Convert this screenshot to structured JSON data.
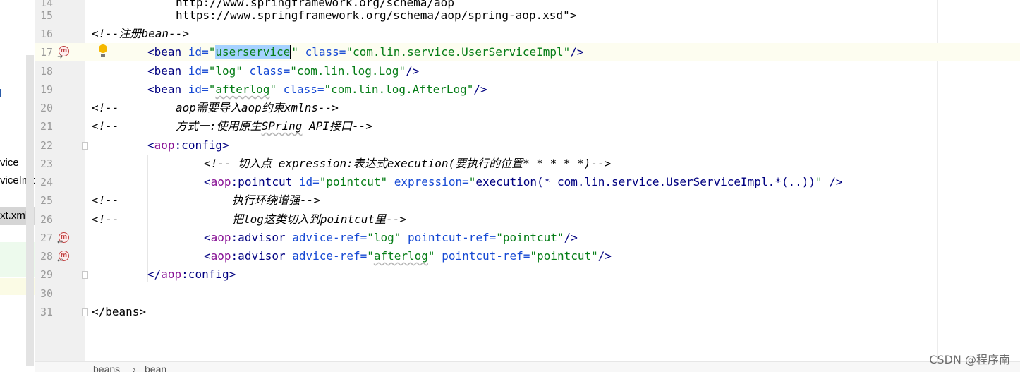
{
  "left_panel": {
    "items": [
      "vice",
      "viceImp",
      "xt.xml"
    ]
  },
  "lines": [
    {
      "num": "14",
      "text": "http://www.springframework.org/schema/aop"
    },
    {
      "num": "15",
      "text": "https://www.springframework.org/schema/aop/spring-aop.xsd\">"
    },
    {
      "num": "16"
    },
    {
      "num": "17"
    },
    {
      "num": "18"
    },
    {
      "num": "19"
    },
    {
      "num": "20"
    },
    {
      "num": "21"
    },
    {
      "num": "22"
    },
    {
      "num": "23"
    },
    {
      "num": "24"
    },
    {
      "num": "25"
    },
    {
      "num": "26"
    },
    {
      "num": "27"
    },
    {
      "num": "28"
    },
    {
      "num": "29"
    },
    {
      "num": "30"
    },
    {
      "num": "31"
    }
  ],
  "code": {
    "l16_comment": "<!--注册bean-->",
    "l17": {
      "open": "<bean ",
      "id_attr": "id=",
      "q1": "\"",
      "id_val": "userservice",
      "q2": "\" ",
      "class_attr": "class=",
      "class_val": "\"com.lin.service.UserServiceImpl\"",
      "close": "/>"
    },
    "l18": {
      "open": "<bean ",
      "id_attr": "id=",
      "id_val": "\"log\" ",
      "class_attr": "class=",
      "class_val": "\"com.lin.log.Log\"",
      "close": "/>"
    },
    "l19": {
      "open": "<bean ",
      "id_attr": "id=",
      "q1": "\"",
      "id_val": "afterlog",
      "q2": "\" ",
      "class_attr": "class=",
      "class_val": "\"com.lin.log.AfterLog\"",
      "close": "/>"
    },
    "l20_a": "<!--",
    "l20_b": "aop需要导入aop约束xmlns-->",
    "l21_a": "<!--",
    "l21_b1": "方式一:使用原生",
    "l21_b2": "SPring",
    "l21_b3": " API接口-->",
    "l22": {
      "lt": "<",
      "ns": "aop",
      "tag": ":config",
      "gt": ">"
    },
    "l23_comment": "<!-- 切入点 expression:表达式execution(要执行的位置* * * * *)-->",
    "l24": {
      "lt": "<",
      "ns": "aop",
      "tag": ":pointcut ",
      "id_attr": "id=",
      "id_val": "\"pointcut\" ",
      "expr_attr": "expression=",
      "expr_q1": "\"",
      "expr_val": "execution(* com.lin.service.UserServiceImpl.*(..))",
      "expr_q2": "\"",
      "close": " />"
    },
    "l25_a": "<!--",
    "l25_b": "执行环绕增强-->",
    "l26_a": "<!--",
    "l26_b": "把log这类切入到pointcut里-->",
    "l27": {
      "lt": "<",
      "ns": "aop",
      "tag": ":advisor ",
      "a1": "advice-ref=",
      "v1": "\"log\" ",
      "a2": "pointcut-ref=",
      "v2": "\"pointcut\"",
      "close": "/>"
    },
    "l28": {
      "lt": "<",
      "ns": "aop",
      "tag": ":advisor ",
      "a1": "advice-ref=",
      "q1": "\"",
      "v1": "afterlog",
      "q2": "\" ",
      "a2": "pointcut-ref=",
      "v2": "\"pointcut\"",
      "close": "/>"
    },
    "l29": {
      "lt": "</",
      "ns": "aop",
      "tag": ":config",
      "gt": ">"
    },
    "l31": "</beans>"
  },
  "gutter_icons": {
    "method_marker": "m"
  },
  "breadcrumb": [
    "beans",
    "›",
    "bean"
  ],
  "watermark": "CSDN @程序南"
}
